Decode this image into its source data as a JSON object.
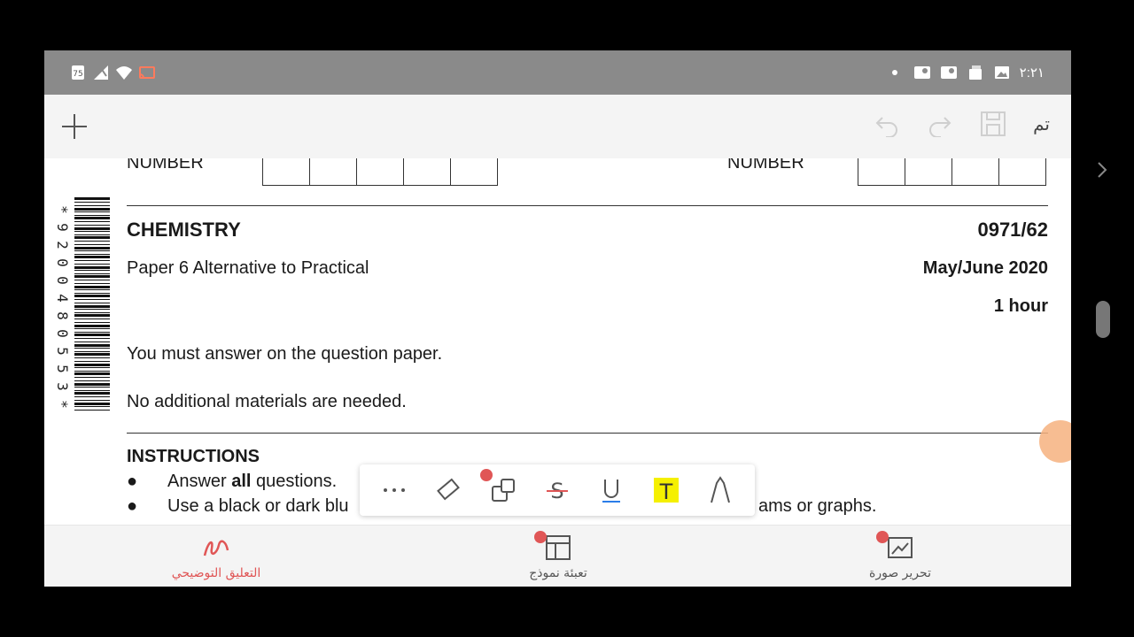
{
  "status_bar": {
    "time": "٢:٢١",
    "battery": "75"
  },
  "toolbar": {
    "done_label": "تم"
  },
  "document": {
    "number_label_left": "NUMBER",
    "number_label_right": "NUMBER",
    "barcode_digits": "*9200480553*",
    "subject": "CHEMISTRY",
    "code": "0971/62",
    "paper_title": "Paper 6 Alternative to Practical",
    "session": "May/June 2020",
    "duration": "1 hour",
    "answer_note": "You must answer on the question paper.",
    "materials_note": "No additional materials are needed.",
    "instructions_heading": "INSTRUCTIONS",
    "instr_1_pre": "Answer ",
    "instr_1_bold": "all",
    "instr_1_post": " questions.",
    "instr_2_pre": "Use a black or dark blu",
    "instr_2_post": "ams or graphs."
  },
  "annotation_toolbar": {
    "tools": [
      "more",
      "eraser",
      "shapes",
      "strikethrough",
      "underline",
      "highlight",
      "pen"
    ],
    "highlight_color": "#f5f000"
  },
  "bottom_bar": {
    "annotate_label": "التعليق التوضيحي",
    "fill_form_label": "تعبئة نموذج",
    "edit_image_label": "تحرير صورة",
    "accent_color": "#e05656"
  }
}
